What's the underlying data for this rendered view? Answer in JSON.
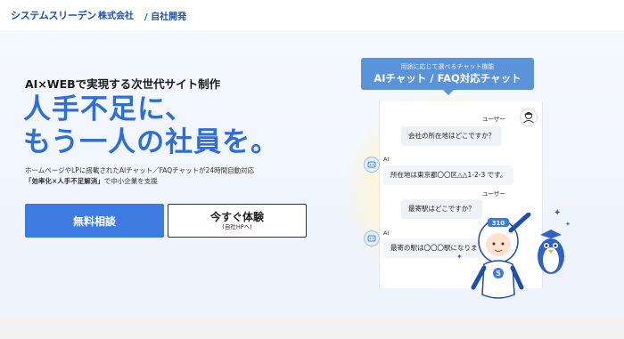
{
  "header": {
    "logo_main": "システムスリーデン",
    "logo_suffix": "株式会社",
    "section": "/ 自社開発"
  },
  "hero": {
    "eyebrow": "AI×WEBで実現する次世代サイト制作",
    "headline_line1": "人手不足に、",
    "headline_line2": "もう一人の社員を。",
    "desc_line1": "ホームページやLPに搭載されたAIチャット／FAQチャットが24時間自動対応",
    "desc_line2_bold": "「効率化×人手不足解消」",
    "desc_line2_rest": "で中小企業を支援"
  },
  "buttons": {
    "primary": "無料相談",
    "secondary_main": "今すぐ体験",
    "secondary_sub": "(自社HPへ)"
  },
  "chat": {
    "tooltip_small": "用途に応じて選べるチャット機能",
    "tooltip_big": "AIチャット / FAQ対応チャット",
    "user_label": "ユーザー",
    "ai_label": "AI",
    "messages": [
      "会社の所在地はどこですか？",
      "所在地は東京都〇〇区△△1-2-3 です。",
      "最寄駅はどこですか？",
      "最寄の駅は〇〇〇駅になりま"
    ],
    "mascot_badge": "310",
    "mascot_emblem": "5"
  },
  "colors": {
    "brand_blue": "#2f6ed6",
    "button_blue": "#3e7be0",
    "tooltip_blue": "#5b93d8"
  },
  "icons": [
    "user-avatar-icon",
    "ai-chat-icon",
    "mascot-robot",
    "penguin-mascot",
    "sparkle-icon"
  ]
}
